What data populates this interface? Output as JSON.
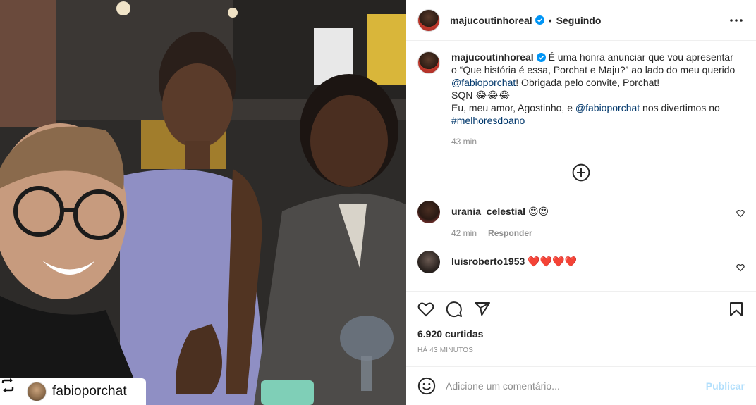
{
  "post": {
    "author": "majucoutinhoreal",
    "follow_status": "Seguindo",
    "separator": "•",
    "colors": {
      "link": "#00376b",
      "verified": "#0095f6",
      "publish_disabled": "#b2dffc",
      "heart": "#ed4956"
    }
  },
  "photo": {
    "repost_user": "fabioporchat"
  },
  "caption": {
    "username": "majucoutinhoreal",
    "part1": " É uma honra anunciar que vou apresentar o “Que história é essa, Porchat e Maju?” ao lado do meu querido ",
    "mention1": "@fabioporchat",
    "part2": "! Obrigada pelo convite, Porchat!",
    "line_sqn": "SQN 😂😂😂",
    "part3": "Eu, meu amor, Agostinho, e ",
    "mention2": "@fabioporchat",
    "part4": " nos divertimos no ",
    "hashtag": "#melhoresdoano",
    "time": "43 min"
  },
  "comments": [
    {
      "username": "urania_celestial",
      "text": "😍😍",
      "time": "42 min",
      "reply_label": "Responder"
    },
    {
      "username": "luisroberto1953",
      "text": "❤️❤️❤️❤️"
    }
  ],
  "stats": {
    "likes": "6.920 curtidas",
    "posted_ago": "HÁ 43 MINUTOS"
  },
  "composer": {
    "placeholder": "Adicione um comentário...",
    "publish_label": "Publicar"
  },
  "icons": {
    "repost": "repost-icon",
    "verified": "verified-badge-icon",
    "more": "more-options-icon",
    "load_more": "load-more-comments-icon",
    "like": "heart-icon",
    "comment": "comment-icon",
    "share": "share-icon",
    "save": "bookmark-icon",
    "emoji": "emoji-icon"
  }
}
